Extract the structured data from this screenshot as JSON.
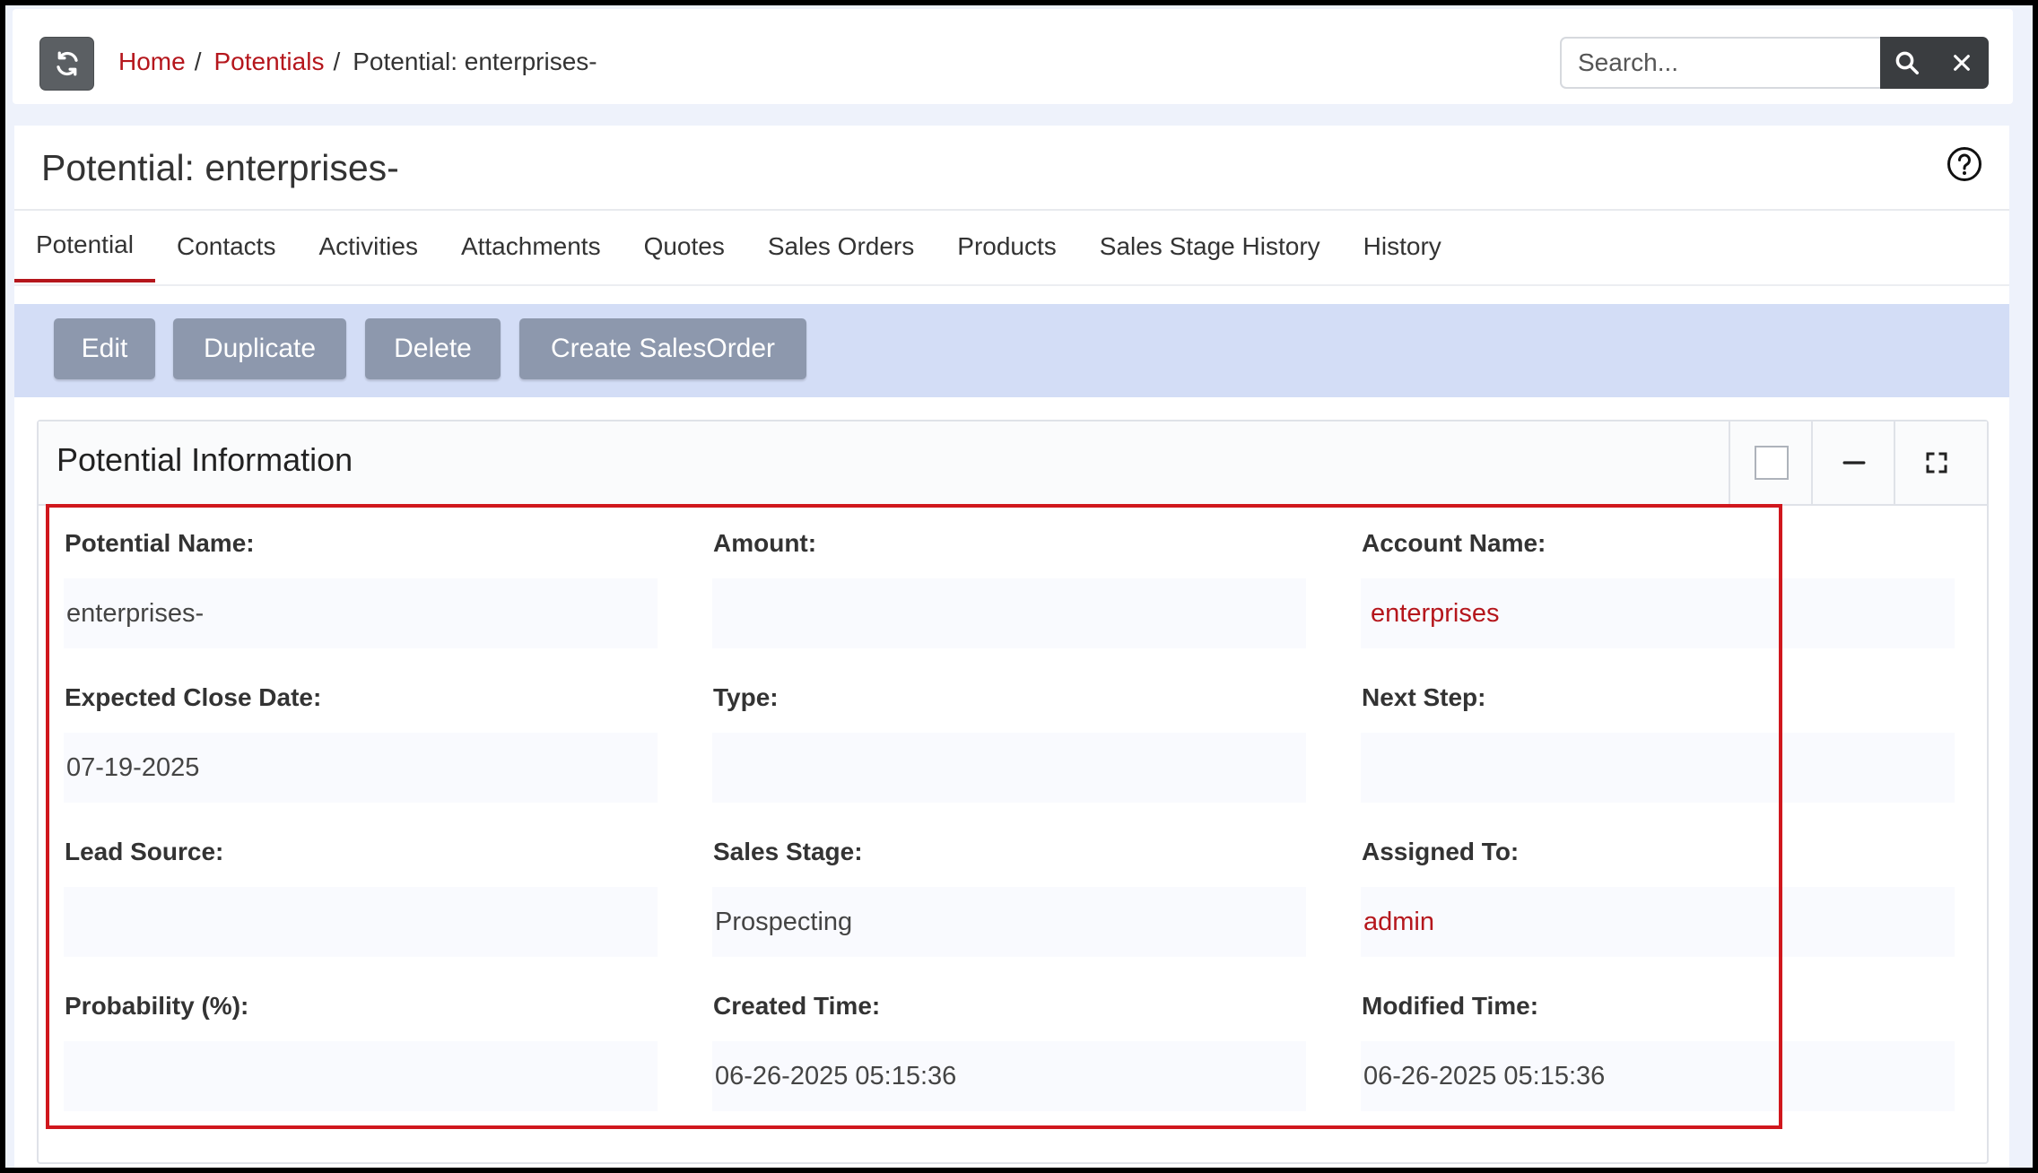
{
  "breadcrumb": {
    "home": "Home",
    "sep1": "/",
    "potentials": "Potentials",
    "sep2": "/",
    "current": "Potential: enterprises-"
  },
  "search": {
    "placeholder": "Search...",
    "value": ""
  },
  "page": {
    "title": "Potential: enterprises-"
  },
  "tabs": [
    {
      "label": "Potential",
      "active": true
    },
    {
      "label": "Contacts"
    },
    {
      "label": "Activities"
    },
    {
      "label": "Attachments"
    },
    {
      "label": "Quotes"
    },
    {
      "label": "Sales Orders"
    },
    {
      "label": "Products"
    },
    {
      "label": "Sales Stage History"
    },
    {
      "label": "History"
    }
  ],
  "actions": {
    "edit": "Edit",
    "duplicate": "Duplicate",
    "delete": "Delete",
    "create_salesorder": "Create SalesOrder"
  },
  "block": {
    "title": "Potential Information",
    "fields": {
      "potential_name": {
        "label": "Potential Name:",
        "value": "enterprises-"
      },
      "amount": {
        "label": "Amount:",
        "value": ""
      },
      "account_name": {
        "label": "Account Name:",
        "value": "enterprises"
      },
      "expected_close_date": {
        "label": "Expected Close Date:",
        "value": "07-19-2025"
      },
      "type": {
        "label": "Type:",
        "value": ""
      },
      "next_step": {
        "label": "Next Step:",
        "value": ""
      },
      "lead_source": {
        "label": "Lead Source:",
        "value": ""
      },
      "sales_stage": {
        "label": "Sales Stage:",
        "value": "Prospecting"
      },
      "assigned_to": {
        "label": "Assigned To:",
        "value": "admin"
      },
      "probability": {
        "label": "Probability (%):",
        "value": ""
      },
      "created_time": {
        "label": "Created Time:",
        "value": "06-26-2025 05:15:36"
      },
      "modified_time": {
        "label": "Modified Time:",
        "value": "06-26-2025 05:15:36"
      }
    }
  },
  "colors": {
    "link": "#b5161c",
    "action_button": "#8d98ad",
    "action_bar": "#d3ddf6",
    "highlight": "#d0171d"
  },
  "icons": {
    "refresh": "refresh-icon",
    "search": "search-icon",
    "close": "close-icon",
    "help": "help-circle-icon",
    "minimize": "minus-icon",
    "fullscreen": "fullscreen-icon"
  }
}
